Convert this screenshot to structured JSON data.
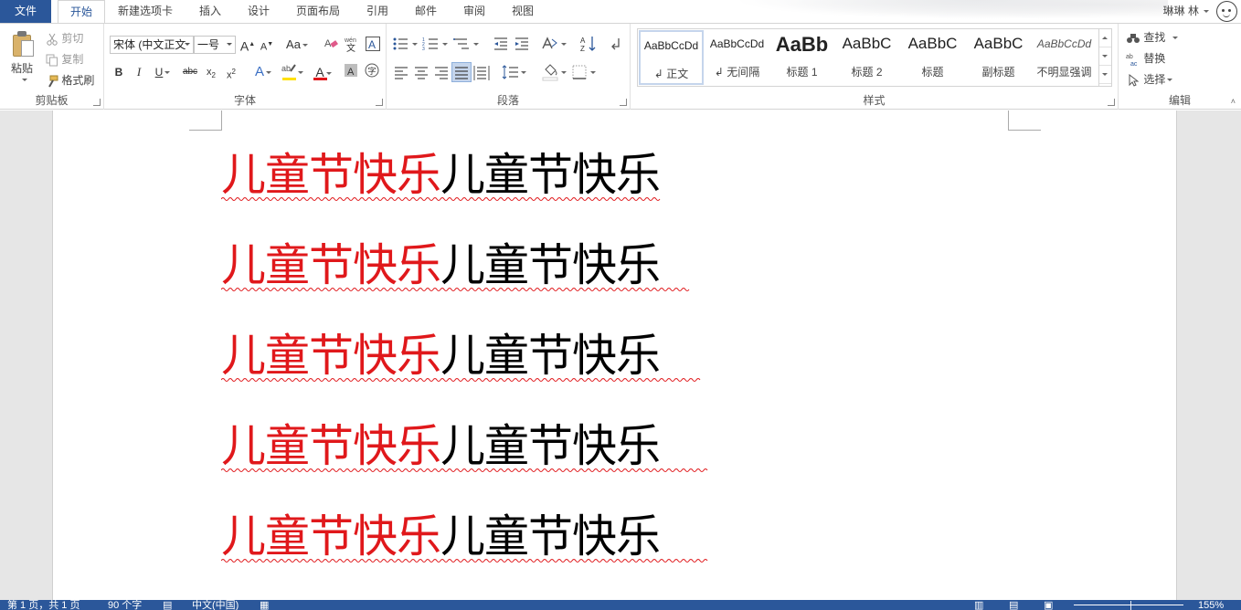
{
  "tabs": {
    "file": "文件",
    "home": "开始",
    "new_tab": "新建选项卡",
    "insert": "插入",
    "design": "设计",
    "layout": "页面布局",
    "references": "引用",
    "mailings": "邮件",
    "review": "审阅",
    "view": "视图"
  },
  "user": {
    "name": "琳琳 林"
  },
  "clipboard": {
    "paste": "粘贴",
    "cut": "剪切",
    "copy": "复制",
    "format_painter": "格式刷",
    "label": "剪贴板"
  },
  "font": {
    "family": "宋体 (中文正文",
    "size": "一号",
    "label": "字体",
    "font_color": "#e0181b",
    "highlight_color": "#ffe000"
  },
  "paragraph": {
    "label": "段落"
  },
  "styles": {
    "label": "样式",
    "items": [
      {
        "preview": "AaBbCcDd",
        "name": "正文"
      },
      {
        "preview": "AaBbCcDd",
        "name": "无间隔"
      },
      {
        "preview": "AaBb",
        "name": "标题 1"
      },
      {
        "preview": "AaBbC",
        "name": "标题 2"
      },
      {
        "preview": "AaBbC",
        "name": "标题"
      },
      {
        "preview": "AaBbC",
        "name": "副标题"
      },
      {
        "preview": "AaBbCcDd",
        "name": "不明显强调"
      }
    ]
  },
  "editing": {
    "find": "查找",
    "replace": "替换",
    "select": "选择",
    "label": "编辑"
  },
  "document": {
    "lines": [
      {
        "red": "儿童节快乐",
        "black": "儿童节快乐"
      },
      {
        "red": "儿童节快乐",
        "black": "儿童节快乐"
      },
      {
        "red": "儿童节快乐",
        "black": "儿童节快乐"
      },
      {
        "red": "儿童节快乐",
        "black": "儿童节快乐"
      },
      {
        "red": "儿童节快乐",
        "black": "儿童节快乐"
      }
    ]
  },
  "status": {
    "page": "第 1 页，共 1 页",
    "words": "90 个字",
    "language": "中文(中国)",
    "zoom": "155%"
  },
  "colors": {
    "accent": "#2b579a",
    "text_red": "#e0181b"
  }
}
